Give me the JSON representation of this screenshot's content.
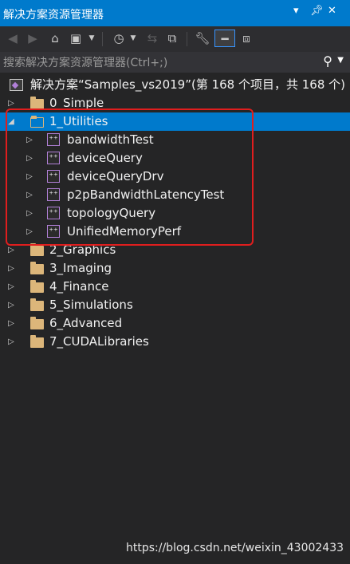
{
  "window": {
    "title": "解决方案资源管理器",
    "dropdown_icon": "chevron-down-icon",
    "pin_icon": "pin-icon",
    "close_icon": "close-icon"
  },
  "toolbar": {
    "buttons": [
      {
        "name": "back-button",
        "icon": "arrow-left-icon"
      },
      {
        "name": "forward-button",
        "icon": "arrow-right-icon"
      },
      {
        "name": "home-button",
        "icon": "home-icon"
      },
      {
        "name": "switch-views-button",
        "icon": "switch-views-icon"
      },
      {
        "name": "pending-changes-filter-button",
        "icon": "history-icon"
      },
      {
        "name": "sync-button",
        "icon": "sync-icon"
      },
      {
        "name": "collapse-all-button",
        "icon": "collapse-all-icon"
      },
      {
        "name": "properties-button",
        "icon": "wrench-icon"
      },
      {
        "name": "preview-selected-button",
        "icon": "preview-icon"
      },
      {
        "name": "class-view-button",
        "icon": "class-diagram-icon"
      }
    ]
  },
  "search": {
    "placeholder": "搜索解决方案资源管理器(Ctrl+;)"
  },
  "tree": {
    "solution_label": "解决方案“Samples_vs2019”(第 168 个项目，共 168 个)",
    "folders_before": [
      {
        "label": "0_Simple"
      }
    ],
    "selected_folder": {
      "label": "1_Utilities"
    },
    "projects": [
      {
        "label": "bandwidthTest"
      },
      {
        "label": "deviceQuery"
      },
      {
        "label": "deviceQueryDrv"
      },
      {
        "label": "p2pBandwidthLatencyTest"
      },
      {
        "label": "topologyQuery"
      },
      {
        "label": "UnifiedMemoryPerf"
      }
    ],
    "folders_after": [
      {
        "label": "2_Graphics"
      },
      {
        "label": "3_Imaging"
      },
      {
        "label": "4_Finance"
      },
      {
        "label": "5_Simulations"
      },
      {
        "label": "6_Advanced"
      },
      {
        "label": "7_CUDALibraries"
      }
    ]
  },
  "watermark": "https://blog.csdn.net/weixin_43002433",
  "colors": {
    "accent": "#007acc",
    "panel_background": "#252526",
    "highlight_border": "#e01e1e",
    "folder": "#dcb67a",
    "project_badge": "#b180d7"
  }
}
